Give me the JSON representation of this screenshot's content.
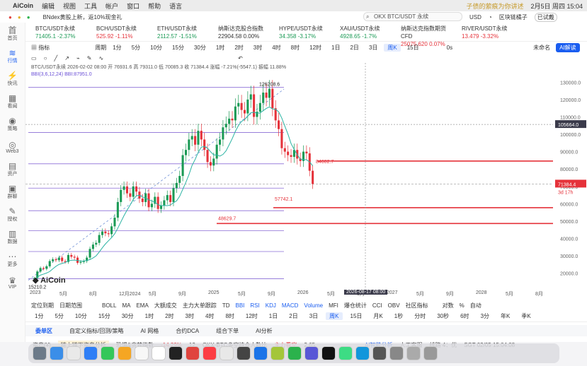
{
  "menubar": {
    "app": "AiCoin",
    "items": [
      "编辑",
      "视图",
      "工具",
      "帐户",
      "窗口",
      "帮助",
      "语言"
    ],
    "right_text": "子债的萦痕为你讲述",
    "clock": "2月5日 周四 15:04"
  },
  "topbar": {
    "announcement": "BNdex黄股上新，返10%现金礼",
    "search": "OKX BTC/USDT 永续",
    "currency": "USD",
    "user": "区块链橘子",
    "status": "已试戴"
  },
  "sidebar": [
    {
      "icon": "首",
      "label": "首页"
    },
    {
      "icon": "≋",
      "label": "行情"
    },
    {
      "icon": "⚡",
      "label": "快讯"
    },
    {
      "icon": "▦",
      "label": "看闻"
    },
    {
      "icon": "◉",
      "label": "策略"
    },
    {
      "icon": "◎",
      "label": "Web3"
    },
    {
      "icon": "▤",
      "label": "资产"
    },
    {
      "icon": "▣",
      "label": "群聊"
    },
    {
      "icon": "✎",
      "label": "授权"
    },
    {
      "icon": "▥",
      "label": "数据"
    },
    {
      "icon": "⋯",
      "label": "更多"
    },
    {
      "icon": "♛",
      "label": "VIP"
    }
  ],
  "tickers": [
    {
      "name": "BTC/USDT永续",
      "value": "71405.1",
      "change": "-2.37%",
      "dir": "up"
    },
    {
      "name": "BCH/USDT永续",
      "value": "525.92",
      "change": "-1.11%",
      "dir": "down"
    },
    {
      "name": "ETH/USDT永续",
      "value": "2112.57",
      "change": "-1.51%",
      "dir": "up"
    },
    {
      "name": "纳斯达克股合指数",
      "value": "22904.58",
      "change": "0.00%",
      "dir": "flat"
    },
    {
      "name": "HYPE/USDT永续",
      "value": "34.358",
      "change": "-3.17%",
      "dir": "up"
    },
    {
      "name": "XAU/USDT永续",
      "value": "4928.65",
      "change": "-1.7%",
      "dir": "up"
    },
    {
      "name": "纳斯达克指数期货CFD",
      "value": "25075.620",
      "change": "0.07%",
      "dir": "down"
    },
    {
      "name": "RIVER/USDT永续",
      "value": "13.479",
      "change": "-3.32%",
      "dir": "down"
    }
  ],
  "toolbar1": {
    "indicator": "指标",
    "period": "周期",
    "timeframes": [
      "1分",
      "5分",
      "10分",
      "15分",
      "30分",
      "1时",
      "2时",
      "3时",
      "4时",
      "8时",
      "12时",
      "1日",
      "2日",
      "3日",
      "周K",
      "15日"
    ],
    "active": "周K",
    "countdown": "0s",
    "unnamed": "未命名",
    "ai": "AI解读"
  },
  "legend": {
    "line1": "BTC/USDT永续 2026-02-02 08:00 开 76931.6 高 79311.0 低 70085.3 收 71384.4 涨幅 -7.21%(-5547.1) 振幅 11.88%",
    "line2": "BBI(3,6,12,24) BBI:87951.0"
  },
  "chart_data": {
    "type": "candlestick",
    "title": "BTC/USDT永续",
    "y_ticks": [
      "130000.0",
      "120000.0",
      "110000.0",
      "100000.0",
      "90000.0",
      "80000.0",
      "70000.0",
      "60000.0",
      "50000.0",
      "40000.0",
      "30000.0",
      "20000.0"
    ],
    "x_ticks": [
      "2023",
      "5月",
      "8月",
      "12月2024",
      "5月",
      "9月",
      "2025",
      "5月",
      "9月",
      "2026",
      "5月",
      "9月",
      "2027",
      "5月",
      "9月",
      "2028",
      "5月",
      "8月"
    ],
    "annotations": [
      {
        "label": "126208.6",
        "value": 126208.6
      },
      {
        "label": "84602.7",
        "value": 84602.7
      },
      {
        "label": "57742.1",
        "value": 57742.1
      },
      {
        "label": "48629.7",
        "value": 48629.7
      },
      {
        "label": "15210.2",
        "value": 15210.2
      }
    ],
    "current_price": "71384.4",
    "countdown": "3d 17h",
    "crosshair_price": "105664.0",
    "crosshair_date": "2026-08-17 08:00"
  },
  "toolbar3": {
    "left": [
      "定位到期",
      "日期范围"
    ],
    "indicators": [
      "BOLL",
      "MA",
      "EMA",
      "大额成交",
      "主力大单跟踪",
      "TD",
      "BBI",
      "RSI",
      "KDJ",
      "MACD",
      "Volume",
      "MFI",
      "爆仓统计",
      "CCI",
      "OBV",
      "社区指标"
    ],
    "right": [
      "对数",
      "%",
      "自动"
    ]
  },
  "toolbar4": [
    "1分",
    "5分",
    "10分",
    "15分",
    "30分",
    "1时",
    "2时",
    "3时",
    "4时",
    "8时",
    "12时",
    "1日",
    "2日",
    "3日",
    "周K",
    "15日",
    "月K",
    "1秒",
    "分时",
    "30秒",
    "6时",
    "3分",
    "年K",
    "季K"
  ],
  "bottomtabs": [
    "委单区",
    "自定义指标/回测/策略",
    "AI 网格",
    "合约DCA",
    "组合下单",
    "AI分析"
  ],
  "statusbar": {
    "asset": "资产(¥)",
    "link": "链上链下资产分析",
    "fear": "恐惧&贪婪指数",
    "fear_val": "-14.29%",
    "fear_num": "12",
    "okx": "OKX-BTC多空持仓人数比",
    "okx_label": "主力看空",
    "okx_val": "2.65",
    "ai_analysis": "AI智能分析",
    "service": "人工客服",
    "line": "线路 4：优",
    "time": "SGT 02/05 15:04:08"
  },
  "colors": {
    "up": "#1a9a55",
    "down": "#e5323a",
    "accent": "#1a5df0"
  }
}
